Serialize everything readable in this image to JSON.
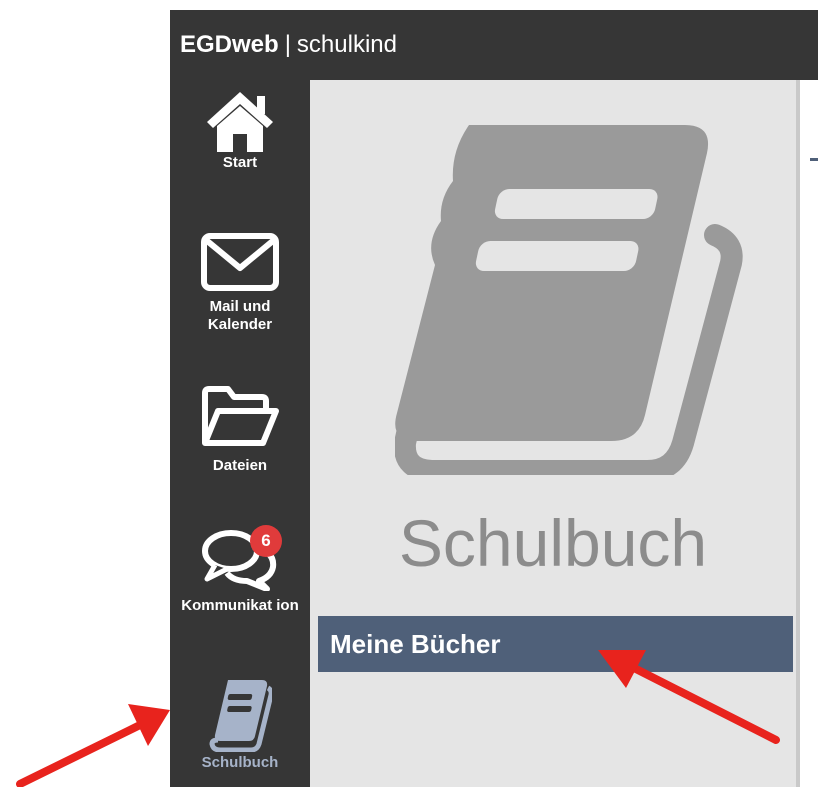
{
  "header": {
    "brand": "EGDweb",
    "separator": "|",
    "user": "schulkind"
  },
  "sidebar": {
    "items": [
      {
        "label": "Start",
        "icon": "home-icon"
      },
      {
        "label": "Mail und Kalender",
        "icon": "envelope-icon"
      },
      {
        "label": "Dateien",
        "icon": "folder-icon"
      },
      {
        "label": "Kommunikat ion",
        "icon": "chat-bubbles-icon",
        "badge": "6"
      },
      {
        "label": "Schulbuch",
        "icon": "book-icon",
        "active": true
      }
    ]
  },
  "main": {
    "hero_icon": "book-icon",
    "title": "Schulbuch",
    "section_header": "Meine Bücher"
  },
  "colors": {
    "topbar": "#363636",
    "sidebar": "#363636",
    "content_bg": "#e5e5e5",
    "section_header_bg": "#4f6079",
    "badge": "#e03b3b",
    "annotation_arrow": "#e8231d"
  }
}
